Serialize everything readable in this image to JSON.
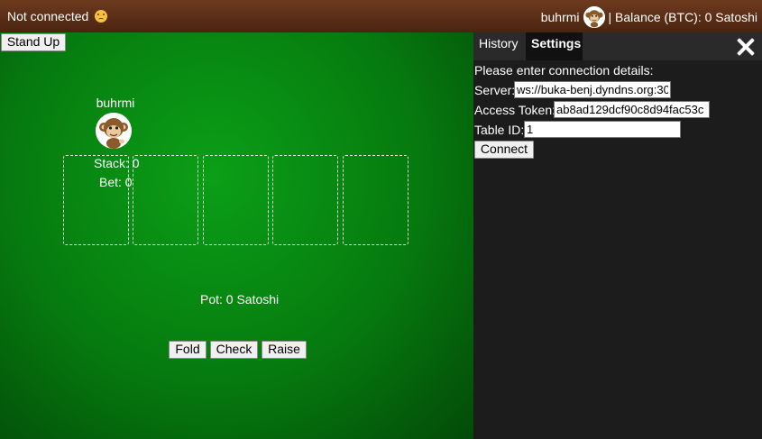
{
  "topbar": {
    "connection_status": "Not connected",
    "status_icon": "worried-face-icon",
    "username": "buhrmi",
    "balance_text": "| Balance (BTC): 0 Satoshi"
  },
  "table": {
    "stand_up_label": "Stand Up",
    "player": {
      "name": "buhrmi",
      "avatar_icon": "monkey-avatar-icon",
      "stack_text": "Stack: 0",
      "bet_text": "Bet: 0"
    },
    "pot_text": "Pot: 0 Satoshi",
    "actions": {
      "fold": "Fold",
      "check": "Check",
      "raise": "Raise"
    }
  },
  "panel": {
    "tabs": [
      {
        "label": "History",
        "active": false
      },
      {
        "label": "Settings",
        "active": true
      }
    ],
    "close_icon": "close-icon",
    "prompt": "Please enter connection details:",
    "server_label": "Server:",
    "server_value": "ws://buka-benj.dyndns.org:30",
    "token_label": "Access Token:",
    "token_value": "ab8ad129dcf90c8d94fac53c",
    "table_id_label": "Table ID:",
    "table_id_value": "1",
    "connect_label": "Connect"
  },
  "colors": {
    "felt": "#078f12",
    "topbar": "#5c2f15",
    "panel": "#1c1c1c"
  }
}
